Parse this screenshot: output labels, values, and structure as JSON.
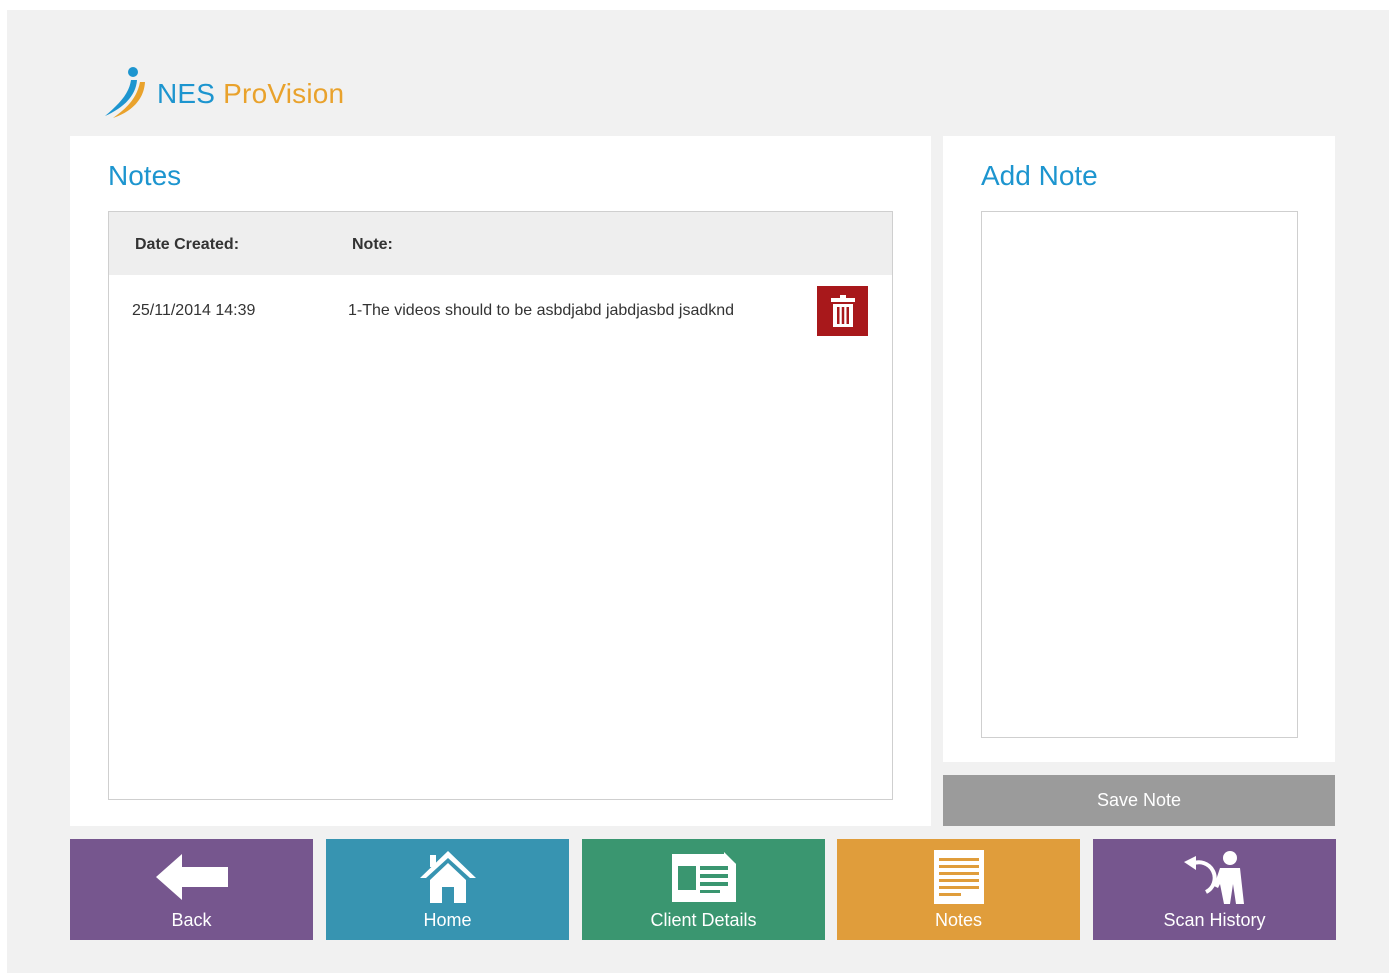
{
  "brand": {
    "name_part1": "NES",
    "name_part2": "ProVision"
  },
  "notes_panel": {
    "title": "Notes",
    "columns": {
      "date": "Date Created:",
      "note": "Note:"
    },
    "rows": [
      {
        "date": "25/11/2014 14:39",
        "note": "1-The videos should to be asbdjabd jabdjasbd jsadknd"
      }
    ]
  },
  "add_note": {
    "title": "Add Note",
    "textarea_value": "",
    "save_label": "Save Note"
  },
  "nav": {
    "back": "Back",
    "home": "Home",
    "client_details": "Client Details",
    "notes": "Notes",
    "scan_history": "Scan History"
  },
  "icons": {
    "logo": "swoosh-person-logo-icon",
    "delete": "trash-icon",
    "back": "arrow-left-icon",
    "home": "house-icon",
    "client_details": "id-card-icon",
    "notes": "document-lines-icon",
    "scan_history": "history-person-icon"
  },
  "colors": {
    "brand_blue": "#1d95cf",
    "brand_orange": "#e9a22c",
    "delete_red": "#a8181b",
    "save_gray": "#9b9b9b",
    "nav_purple": "#76568e",
    "nav_teal": "#3794b1",
    "nav_green": "#3a9670",
    "nav_orange": "#e09d3b"
  }
}
